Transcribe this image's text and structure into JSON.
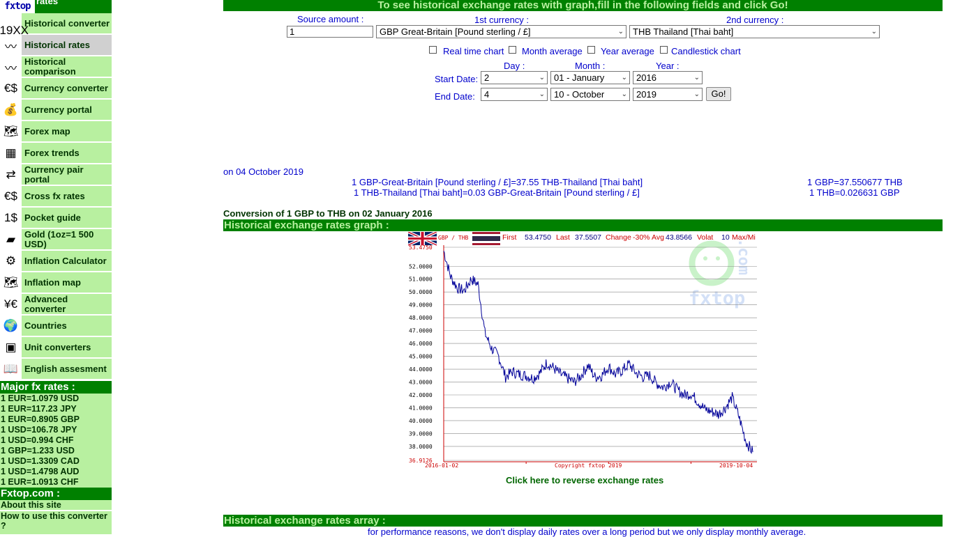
{
  "sidebar": {
    "logo_text": "fxtop",
    "logo_suffix": "rates",
    "items": [
      {
        "label": "Historical converter",
        "icon": "€$19XX"
      },
      {
        "label": "Historical rates",
        "icon": "〰"
      },
      {
        "label": "Historical comparison",
        "icon": "〰"
      },
      {
        "label": "Currency converter",
        "icon": "€$"
      },
      {
        "label": "Currency portal",
        "icon": "💰"
      },
      {
        "label": "Forex map",
        "icon": "🗺"
      },
      {
        "label": "Forex trends",
        "icon": "▦"
      },
      {
        "label": "Currency pair portal",
        "icon": "⇄"
      },
      {
        "label": "Cross fx rates",
        "icon": "€$"
      },
      {
        "label": "Pocket guide",
        "icon": "1$"
      },
      {
        "label": "Gold (1oz=1 500 USD)",
        "icon": "▰"
      },
      {
        "label": "Inflation Calculator",
        "icon": "⚙"
      },
      {
        "label": "Inflation map",
        "icon": "🗺"
      },
      {
        "label": "Advanced converter",
        "icon": "¥€"
      },
      {
        "label": "Countries",
        "icon": "🌍"
      },
      {
        "label": "Unit converters",
        "icon": "▣"
      },
      {
        "label": "English assesment",
        "icon": "📖"
      }
    ],
    "major_header": "Major fx rates :",
    "major_rates": [
      "1 EUR=1.0979 USD",
      "1 EUR=117.23 JPY",
      "1 EUR=0.8905 GBP",
      "1 USD=106.78 JPY",
      "1 USD=0.994 CHF",
      "1 GBP=1.233 USD",
      "1 USD=1.3309 CAD",
      "1 USD=1.4798 AUD",
      "1 EUR=1.0913 CHF"
    ],
    "fxtop_header": "Fxtop.com :",
    "fxtop_links": [
      "About this site",
      "How to use this converter ?"
    ]
  },
  "form": {
    "banner": "To see historical exchange rates with graph,fill in the following fields and click Go!",
    "source_amount_label": "Source amount :",
    "source_amount_value": "1",
    "currency1_label": "1st currency :",
    "currency1_value": "GBP Great-Britain [Pound sterling / £]",
    "currency2_label": "2nd currency :",
    "currency2_value": "THB Thailand [Thai baht]",
    "options": [
      "Real time chart",
      "Month average",
      "Year average",
      "Candlestick chart"
    ],
    "day_label": "Day :",
    "month_label": "Month :",
    "year_label": "Year :",
    "start_label": "Start Date:",
    "end_label": "End Date:",
    "start_day": "2",
    "start_month": "01 - January",
    "start_year": "2016",
    "end_day": "4",
    "end_month": "10 - October",
    "end_year": "2019",
    "go_label": "Go!"
  },
  "result": {
    "date_text": "on 04 October 2019",
    "line1": "1 GBP-Great-Britain [Pound sterling / £]=37.55 THB-Thailand [Thai baht]",
    "line2": "1 THB-Thailand [Thai baht]=0.03 GBP-Great-Britain [Pound sterling / £]",
    "short1": "1 GBP=37.550677 THB",
    "short2": "1 THB=0.026631 GBP",
    "conversion_prefix": "Conversion of ",
    "conversion_amount": "1 GBP",
    "conversion_mid": " to ",
    "conversion_target": "THB",
    "conversion_on": " on ",
    "conversion_date": "02 January 2016"
  },
  "graph_header": "Historical exchange rates graph :",
  "array_header": "Historical exchange rates array :",
  "array_note": "for performance reasons, we don't display daily rates over a long period but we only display monthly average.",
  "reverse_link": "Click here to reverse exchange rates",
  "chart_data": {
    "type": "line",
    "pair": "GBP / THB",
    "stats": {
      "first_label": "First",
      "first": "53.4750",
      "last_label": "Last",
      "last": "37.5507",
      "change_label": "Change",
      "change": "-30%",
      "avg_label": "Avg",
      "avg": "43.8566",
      "volat_label": "Volat",
      "volat": "10",
      "maxmin_label": "Max/Mi"
    },
    "ylim": [
      36.9126,
      53.475
    ],
    "y_ticks": [
      "53.4750",
      "52.0000",
      "51.0000",
      "50.0000",
      "49.0000",
      "48.0000",
      "47.0000",
      "46.0000",
      "45.0000",
      "44.0000",
      "43.0000",
      "42.0000",
      "41.0000",
      "40.0000",
      "39.0000",
      "38.0000",
      "36.9126"
    ],
    "x_start_label": "2016-01-02",
    "x_end_label": "2019-10-04",
    "copyright": "Copyright fxtop 2019",
    "watermark": "fxtop",
    "watermark2": ".com",
    "x": [
      "2016-01",
      "2016-02",
      "2016-03",
      "2016-04",
      "2016-05",
      "2016-06",
      "2016-07",
      "2016-08",
      "2016-09",
      "2016-10",
      "2016-11",
      "2016-12",
      "2017-01",
      "2017-02",
      "2017-03",
      "2017-04",
      "2017-05",
      "2017-06",
      "2017-07",
      "2017-08",
      "2017-09",
      "2017-10",
      "2017-11",
      "2017-12",
      "2018-01",
      "2018-02",
      "2018-03",
      "2018-04",
      "2018-05",
      "2018-06",
      "2018-07",
      "2018-08",
      "2018-09",
      "2018-10",
      "2018-11",
      "2018-12",
      "2019-01",
      "2019-02",
      "2019-03",
      "2019-04",
      "2019-05",
      "2019-06",
      "2019-07",
      "2019-08",
      "2019-09",
      "2019-10"
    ],
    "values": [
      53.2,
      51.2,
      50.3,
      50.1,
      51.0,
      50.6,
      46.8,
      45.6,
      45.0,
      43.4,
      43.8,
      43.6,
      43.5,
      43.3,
      43.7,
      44.5,
      44.1,
      43.6,
      43.3,
      43.0,
      43.5,
      44.3,
      43.4,
      43.5,
      44.2,
      43.6,
      43.9,
      44.4,
      43.7,
      43.4,
      43.5,
      42.9,
      42.6,
      43.0,
      42.4,
      42.0,
      42.1,
      41.5,
      40.9,
      40.7,
      40.5,
      41.0,
      41.8,
      40.3,
      38.4,
      37.55
    ]
  }
}
